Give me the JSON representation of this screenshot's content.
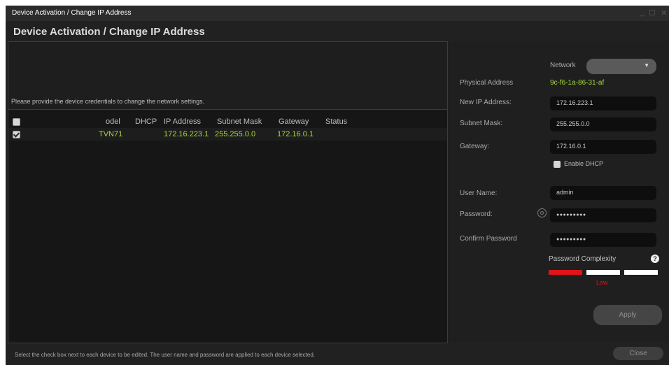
{
  "window": {
    "title": "Device Activation / Change IP Address",
    "heading": "Device Activation / Change IP Address",
    "controls": {
      "minimize": "_",
      "maximize": "☐",
      "close": "✕"
    }
  },
  "left": {
    "message": "Please provide the device credentials to change the network settings.",
    "columns": [
      "odel",
      "DHCP",
      "IP Address",
      "Subnet Mask",
      "Gateway",
      "Status"
    ],
    "rows": [
      {
        "checked": true,
        "model": "TVN71",
        "dhcp": "",
        "ip": "172.16.223.1",
        "subnet": "255.255.0.0",
        "gateway": "172.16.0.1",
        "status": ""
      }
    ]
  },
  "right": {
    "network_label": "Network",
    "network_value": "",
    "physical_address_label": "Physical Address",
    "physical_address": "9c-f6-1a-86-31-af",
    "new_ip_label": "New IP Address:",
    "new_ip": "172.16.223.1",
    "subnet_label": "Subnet Mask:",
    "subnet": "255.255.0.0",
    "gateway_label": "Gateway:",
    "gateway": "172.16.0.1",
    "enable_dhcp_label": "Enable DHCP",
    "username_label": "User Name:",
    "username": "admin",
    "password_label": "Password:",
    "password": "●●●●●●●●●",
    "confirm_password_label": "Confirm Password",
    "confirm_password": "●●●●●●●●●",
    "complexity_label": "Password Complexity",
    "complexity_help": "?",
    "complexity_level": "Low",
    "complexity_score": 1,
    "complexity_max": 3,
    "apply_label": "Apply"
  },
  "footer": {
    "message": "Select the check box next to each device to be edited. The user name and password are applied to each device selected.",
    "close_label": "Close"
  },
  "colors": {
    "accent_green": "#a6d93a",
    "complexity_low": "#e0141a",
    "complexity_empty": "#ffffff"
  }
}
